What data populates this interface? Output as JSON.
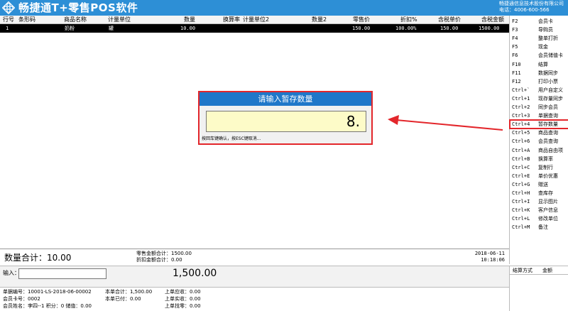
{
  "titlebar": {
    "app_title": "畅捷通T+零售POS软件",
    "company_name": "畅捷通信息技术股份有限公司",
    "phone": "电话：4006-600-566"
  },
  "grid": {
    "columns": [
      "行号",
      "条形码",
      "商品名称",
      "计量单位",
      "数量",
      "换算率",
      "计量单位2",
      "数量2",
      "零售价",
      "折扣%",
      "含税单价",
      "含税金额"
    ],
    "rows": [
      {
        "row_no": "1",
        "barcode": "",
        "name": "奶粉",
        "unit": "罐",
        "qty": "10.00",
        "rate": "",
        "unit2": "",
        "qty2": "",
        "retail_price": "150.00",
        "discount": "100.00%",
        "tax_price": "150.00",
        "tax_amount": "1500.00"
      }
    ]
  },
  "function_keys": [
    {
      "key": "F2",
      "label": "会员卡"
    },
    {
      "key": "F3",
      "label": "导购员"
    },
    {
      "key": "F4",
      "label": "整单打折"
    },
    {
      "key": "F5",
      "label": "现金"
    },
    {
      "key": "F6",
      "label": "会员储值卡"
    },
    {
      "key": "F10",
      "label": "结算"
    },
    {
      "key": "F11",
      "label": "数据同步"
    },
    {
      "key": "F12",
      "label": "打印小票"
    },
    {
      "key": "Ctrl+`",
      "label": "用户自定义"
    },
    {
      "key": "Ctrl+1",
      "label": "现存量同步"
    },
    {
      "key": "Ctrl+2",
      "label": "同步会员"
    },
    {
      "key": "Ctrl+3",
      "label": "单据查询"
    },
    {
      "key": "Ctrl+4",
      "label": "暂存数量"
    },
    {
      "key": "Ctrl+5",
      "label": "商品查询"
    },
    {
      "key": "Ctrl+6",
      "label": "会员查询"
    },
    {
      "key": "Ctrl+A",
      "label": "商品自由项"
    },
    {
      "key": "Ctrl+B",
      "label": "换算率"
    },
    {
      "key": "Ctrl+C",
      "label": "复制行"
    },
    {
      "key": "Ctrl+E",
      "label": "单价优惠"
    },
    {
      "key": "Ctrl+G",
      "label": "赠送"
    },
    {
      "key": "Ctrl+H",
      "label": "查库存"
    },
    {
      "key": "Ctrl+I",
      "label": "显示图片"
    },
    {
      "key": "Ctrl+K",
      "label": "客户信息"
    },
    {
      "key": "Ctrl+L",
      "label": "修改单位"
    },
    {
      "key": "Ctrl+M",
      "label": "备注"
    }
  ],
  "dialog": {
    "title": "请输入暂存数量",
    "value": "8.",
    "hint": "按回车键确认，按ESC键取消..."
  },
  "summary": {
    "total_qty": "数量合计：10.00",
    "retail_total": "零售金额合计：1500.00",
    "discount_total": "折扣金额合计：0.00",
    "date": "2018-06-11",
    "time": "10:18:06"
  },
  "input_row": {
    "label": "输入：",
    "value": "",
    "amount": "1,500.00"
  },
  "payment_panel": {
    "method_header": "结算方式",
    "amount_header": "金额"
  },
  "footer": {
    "doc_no": "单据编号：10001-LS-2018-06-00002",
    "member_card": "会员卡号：0002",
    "member_info": "会员姓名：李四--1 积分：0 储值：0.00",
    "bill_total": "本单合计：1,500.00",
    "bill_paid": "本单已付：0.00",
    "last_receivable": "上单应收：0.00",
    "last_received": "上单实收：0.00",
    "last_change": "上单找零：0.00"
  },
  "colors": {
    "titlebar": "#2d8fd6",
    "dialog_title": "#1f77c9",
    "highlight_red": "#e3262b",
    "input_yellow": "#fdfbc8"
  }
}
